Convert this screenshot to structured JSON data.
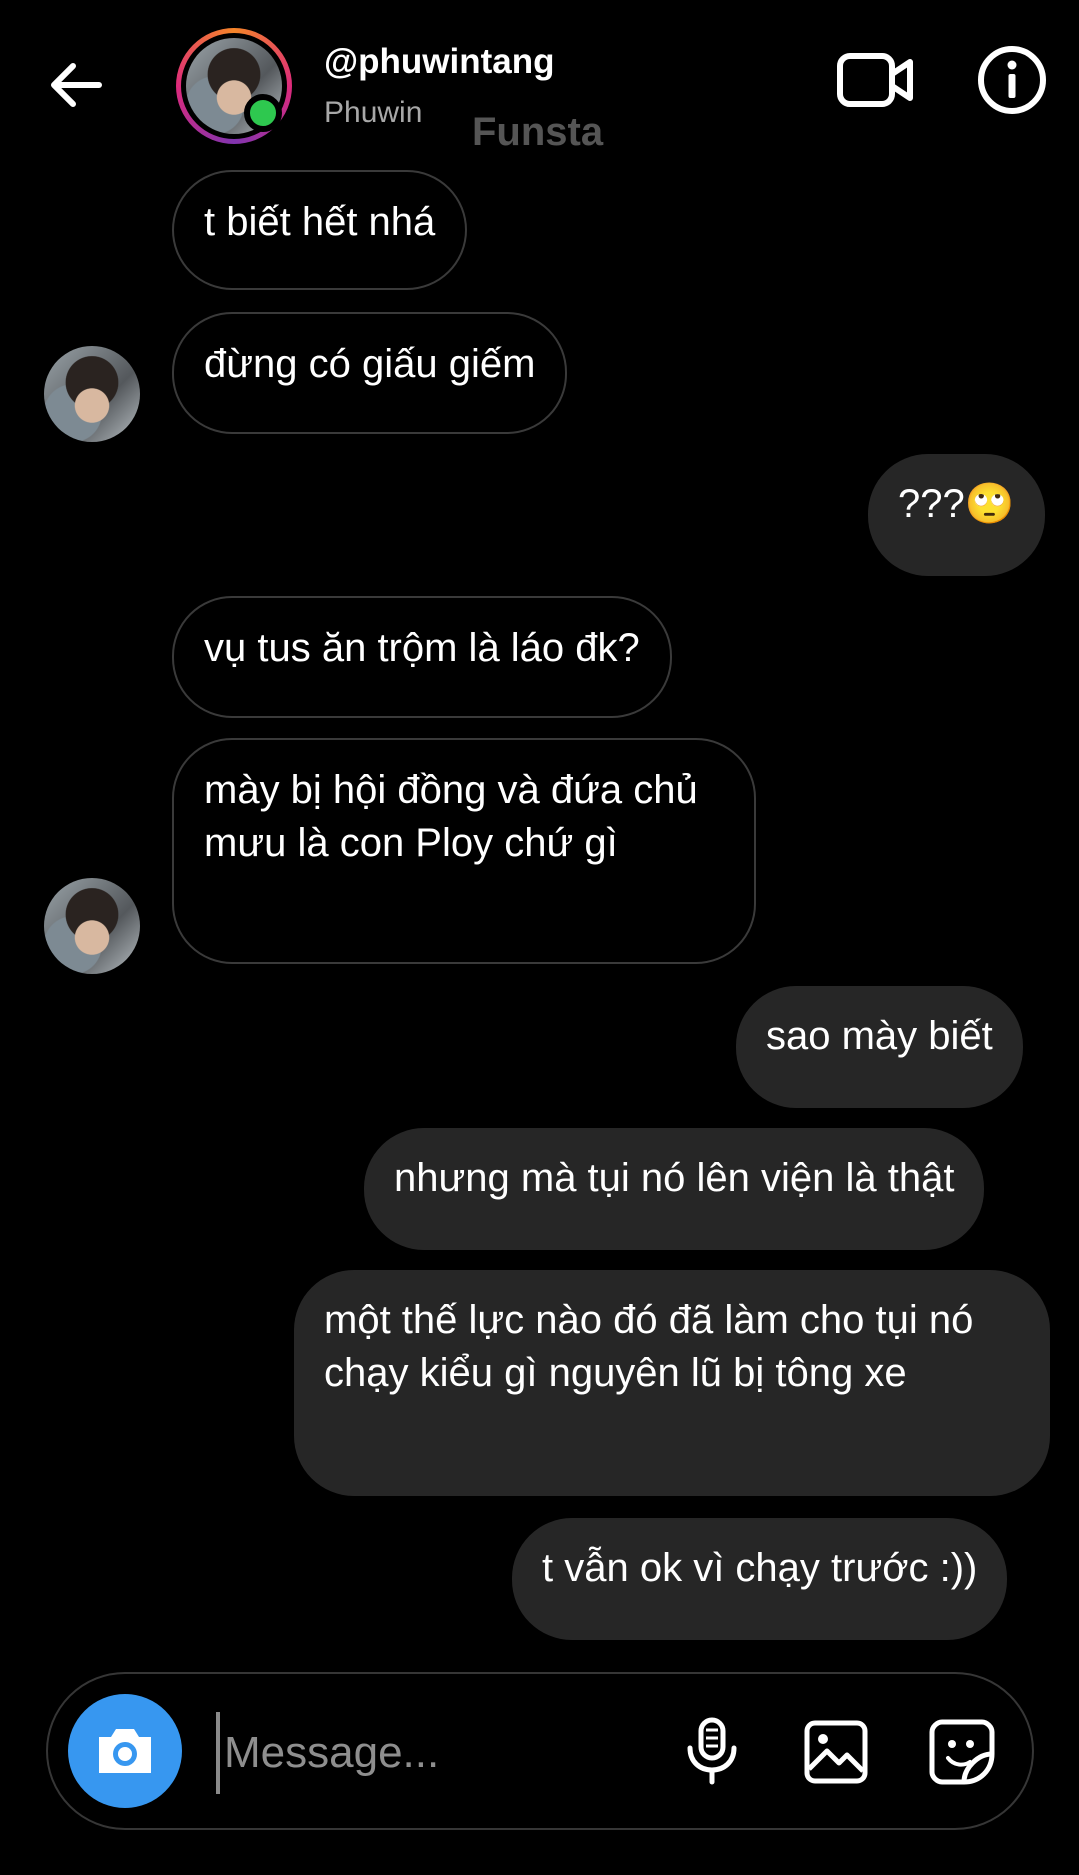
{
  "header": {
    "username": "@phuwintang",
    "display_name": "Phuwin",
    "overlay_label": "Funsta",
    "status": "online"
  },
  "icons": {
    "back": "back-arrow-icon",
    "video": "video-camera-icon",
    "info": "info-icon",
    "camera": "camera-icon",
    "mic": "microphone-icon",
    "gallery": "gallery-icon",
    "sticker": "sticker-icon"
  },
  "colors": {
    "background": "#000000",
    "outgoing_bubble": "#262626",
    "incoming_border": "#3a3a3a",
    "camera_button": "#3797f0",
    "online": "#2ec84f"
  },
  "messages": [
    {
      "side": "in",
      "text": "t biết hết nhá"
    },
    {
      "side": "in",
      "text": "đừng có giấu giếm"
    },
    {
      "side": "out",
      "text": "???🙄"
    },
    {
      "side": "in",
      "text": "vụ tus ăn trộm là láo đk?"
    },
    {
      "side": "in",
      "text": "mày bị hội đồng và đứa chủ mưu là con Ploy chứ gì"
    },
    {
      "side": "out",
      "text": "sao mày biết"
    },
    {
      "side": "out",
      "text": "nhưng mà tụi nó lên viện là thật"
    },
    {
      "side": "out",
      "text": "một thế lực nào đó đã làm cho tụi nó chạy kiểu gì nguyên lũ bị tông xe"
    },
    {
      "side": "out",
      "text": "t vẫn ok vì chạy trước :))"
    }
  ],
  "composer": {
    "placeholder": "Message..."
  }
}
